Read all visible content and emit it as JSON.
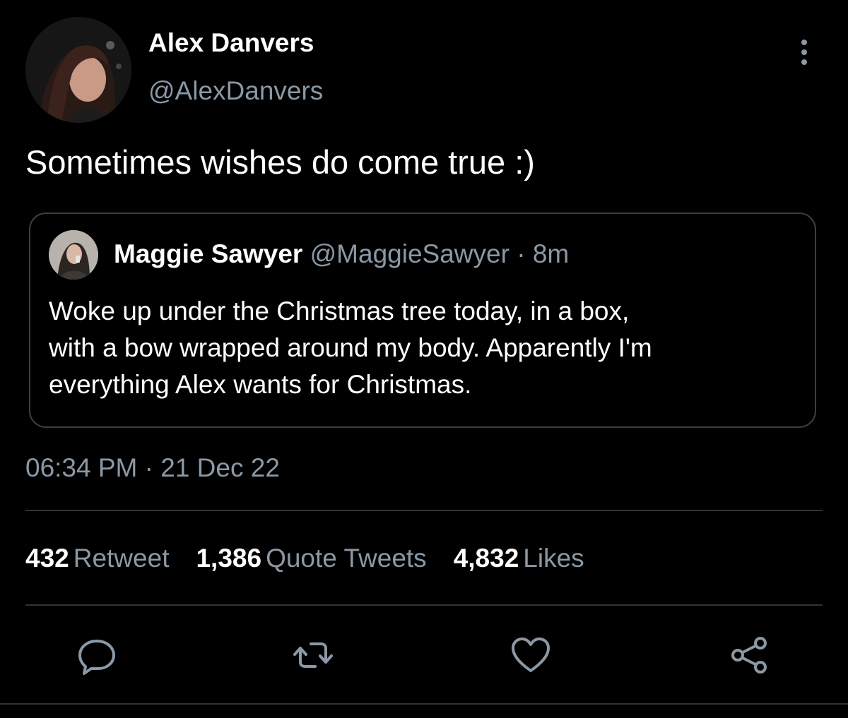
{
  "author": {
    "display_name": "Alex Danvers",
    "handle": "@AlexDanvers",
    "avatar_icon": "user-photo"
  },
  "tweet": {
    "text": "Sometimes wishes do come true :)",
    "timestamp": "06:34 PM · 21 Dec 22"
  },
  "quoted_tweet": {
    "display_name": "Maggie Sawyer",
    "handle": "@MaggieSawyer",
    "separator": " · ",
    "age": "8m",
    "text_lines": [
      "Woke up under the Christmas tree today, in a box,",
      "with a bow wrapped around my body. Apparently I'm",
      "everything Alex wants for Christmas."
    ]
  },
  "stats": [
    {
      "count": "432",
      "label": "Retweet"
    },
    {
      "count": "1,386",
      "label": "Quote Tweets"
    },
    {
      "count": "4,832",
      "label": "Likes"
    }
  ],
  "actions": [
    {
      "name": "reply",
      "icon": "speech-bubble-icon"
    },
    {
      "name": "retweet",
      "icon": "retweet-icon"
    },
    {
      "name": "like",
      "icon": "heart-icon"
    },
    {
      "name": "share",
      "icon": "share-icon"
    }
  ],
  "colors": {
    "background": "#000000",
    "primary_text": "#ffffff",
    "secondary_text": "#8b98a5",
    "border": "#3a3f44",
    "divider": "#2f3336",
    "icon": "#8b98a5"
  }
}
